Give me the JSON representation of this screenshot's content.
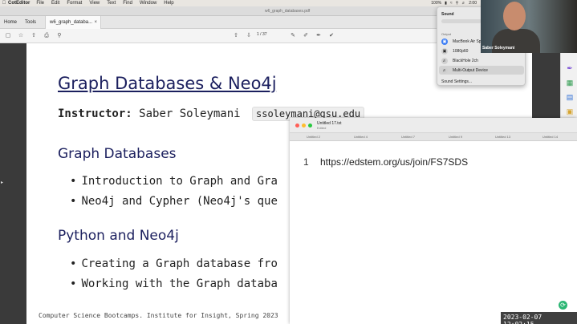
{
  "menubar": {
    "app": "CotEditor",
    "items": [
      "File",
      "Edit",
      "Format",
      "View",
      "Text",
      "Find",
      "Window",
      "Help"
    ],
    "battery": "100%",
    "clock": "2:00"
  },
  "window": {
    "doc_title": "w6_graph_databases.pdf",
    "tabs": {
      "home": "Home",
      "tools": "Tools",
      "active": "w6_graph_databa...",
      "close": "×"
    },
    "toolbar": {
      "page_current": "1",
      "page_total": "/ 37"
    }
  },
  "slide": {
    "title": "Graph Databases & Neo4j",
    "instructor_label": "Instructor:",
    "instructor_name": "Saber Soleymani",
    "email": "ssoleymani@gsu.edu",
    "sections": [
      {
        "heading": "Graph Databases",
        "bullets": [
          "Introduction to Graph and Gra",
          "Neo4j and Cypher (Neo4j's que"
        ]
      },
      {
        "heading": "Python and Neo4j",
        "bullets": [
          "Creating a Graph database fro",
          "Working with the Graph databa"
        ]
      }
    ],
    "footer": "Computer Science Bootcamps. Institute for Insight, Spring 2023"
  },
  "editor": {
    "filename": "Untitled 17.txt",
    "state": "Edited",
    "tabs": [
      "Untitled 2",
      "Untitled 4",
      "Untitled 7",
      "Untitled 9",
      "Untitled 13",
      "Untitled 14"
    ],
    "line_number": "1",
    "line_text": "https://edstem.org/us/join/FS7SDS"
  },
  "sound_menu": {
    "heading": "Sound",
    "volume_fraction": 0.0,
    "output_label": "Output",
    "devices": [
      {
        "name": "MacBook Air Spe",
        "icon": "laptop-icon",
        "active": false
      },
      {
        "name": "1080p60",
        "icon": "monitor-icon",
        "active": false
      },
      {
        "name": "BlackHole 2ch",
        "icon": "speaker-icon",
        "active": false
      },
      {
        "name": "Multi-Output Device",
        "icon": "speaker-icon",
        "active": true
      }
    ],
    "settings": "Sound Settings..."
  },
  "webcam": {
    "name": "Saber Soleymani"
  },
  "timestamp": "2023-02-07  12:02:15",
  "colors": {
    "heading": "#1b1f5e",
    "rec": "#2bb673"
  }
}
